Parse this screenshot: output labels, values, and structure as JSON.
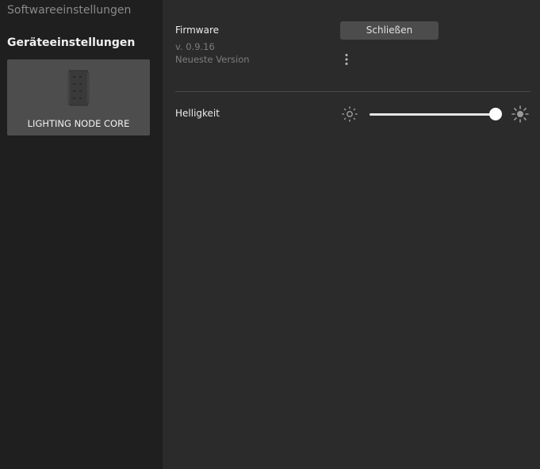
{
  "sidebar": {
    "software_settings": "Softwareeinstellungen",
    "device_settings": "Geräteeinstellungen",
    "device": {
      "name": "LIGHTING NODE CORE",
      "image_icon": "lighting-node-core-device"
    }
  },
  "firmware": {
    "title": "Firmware",
    "version": "v. 0.9.16",
    "status": "Neueste Version",
    "close_label": "Schließen",
    "menu_icon": "more-vertical-icon"
  },
  "brightness": {
    "label": "Helligkeit",
    "value_fraction": 0.95,
    "low_icon": "sun-dim-icon",
    "high_icon": "sun-bright-icon"
  },
  "colors": {
    "sidebar_bg": "#1f1f1f",
    "main_bg": "#2b2b2b",
    "card_bg": "#4d4d4d",
    "button_bg": "#4c4c4c"
  }
}
